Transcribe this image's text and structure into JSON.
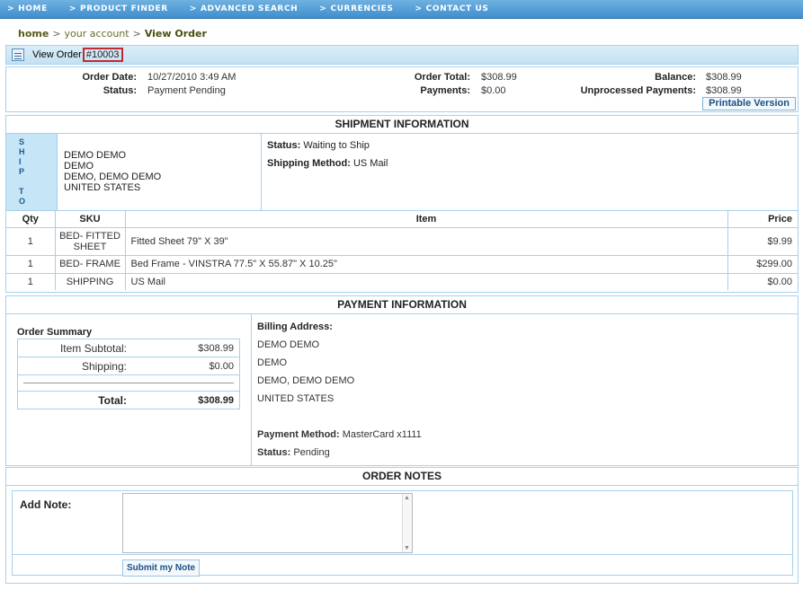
{
  "nav": [
    {
      "sep": ">",
      "label": "HOME"
    },
    {
      "sep": ">",
      "label": "PRODUCT FINDER"
    },
    {
      "sep": ">",
      "label": "ADVANCED SEARCH"
    },
    {
      "sep": ">",
      "label": "CURRENCIES"
    },
    {
      "sep": ">",
      "label": "CONTACT US"
    }
  ],
  "breadcrumb": {
    "home": "home",
    "sep": ">",
    "account": "your account",
    "current": "View Order"
  },
  "title": {
    "text": "View Order",
    "order_id": "#10003"
  },
  "summary": {
    "order_date_label": "Order Date:",
    "order_date": "10/27/2010 3:49 AM",
    "status_label": "Status:",
    "status": "Payment Pending",
    "order_total_label": "Order Total:",
    "order_total": "$308.99",
    "payments_label": "Payments:",
    "payments": "$0.00",
    "balance_label": "Balance:",
    "balance": "$308.99",
    "unprocessed_label": "Unprocessed Payments:",
    "unprocessed": "$308.99",
    "print_label": "Printable Version"
  },
  "shipment": {
    "header": "SHIPMENT INFORMATION",
    "ship_to_letters": [
      "S",
      "H",
      "I",
      "P",
      "T",
      "O"
    ],
    "address": [
      "DEMO DEMO",
      "DEMO",
      "DEMO, DEMO DEMO",
      "UNITED STATES"
    ],
    "status_label": "Status:",
    "status": "Waiting to Ship",
    "method_label": "Shipping Method:",
    "method": "US Mail",
    "columns": [
      "Qty",
      "SKU",
      "Item",
      "Price"
    ],
    "rows": [
      {
        "qty": "1",
        "sku": "BED- FITTED SHEET",
        "item": "Fitted Sheet 79\" X 39\"",
        "price": "$9.99"
      },
      {
        "qty": "1",
        "sku": "BED- FRAME",
        "item": "Bed Frame - VINSTRA 77.5\" X 55.87\" X 10.25\"",
        "price": "$299.00"
      },
      {
        "qty": "1",
        "sku": "SHIPPING",
        "item": "US Mail",
        "price": "$0.00"
      }
    ]
  },
  "payment": {
    "header": "PAYMENT INFORMATION",
    "order_summary_title": "Order Summary",
    "subtotal_label": "Item Subtotal:",
    "subtotal": "$308.99",
    "shipping_label": "Shipping:",
    "shipping": "$0.00",
    "total_label": "Total:",
    "total": "$308.99",
    "billing_label": "Billing Address:",
    "billing": [
      "DEMO DEMO",
      "DEMO",
      "DEMO, DEMO DEMO",
      "UNITED STATES"
    ],
    "method_label": "Payment Method:",
    "method": "MasterCard x1111",
    "status_label": "Status:",
    "status": "Pending"
  },
  "notes": {
    "header": "ORDER NOTES",
    "add_note_label": "Add Note:",
    "note_value": "",
    "submit_label": "Submit my Note"
  }
}
